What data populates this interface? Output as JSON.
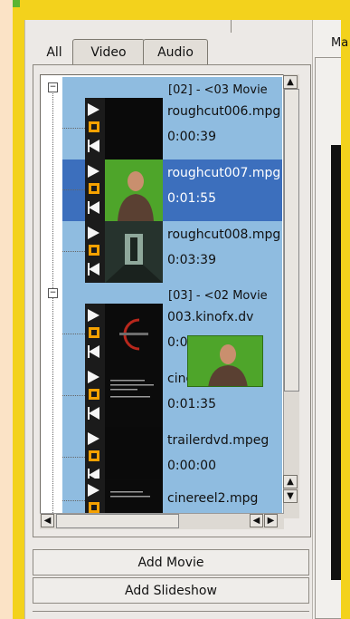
{
  "app": {
    "right_pane_label": "Ma"
  },
  "tabs": [
    {
      "label": "All",
      "active": true
    },
    {
      "label": "Video",
      "active": false
    },
    {
      "label": "Audio",
      "active": false
    }
  ],
  "groups": [
    {
      "label": "[02] - <03 Movie",
      "items": [
        {
          "name": "roughcut006.mpg",
          "duration": "0:00:39",
          "selected": false,
          "thumb": "dark"
        },
        {
          "name": "roughcut007.mpg",
          "duration": "0:01:55",
          "selected": true,
          "thumb": "person-green"
        },
        {
          "name": "roughcut008.mpg",
          "duration": "0:03:39",
          "selected": false,
          "thumb": "corridor"
        }
      ]
    },
    {
      "label": "[03] - <02 Movie",
      "items": [
        {
          "name": "003.kinofx.dv",
          "duration": "0:00:05",
          "selected": false,
          "thumb": "logo"
        },
        {
          "name": "cinereel1.mpg",
          "duration": "0:01:35",
          "selected": false,
          "thumb": "text"
        },
        {
          "name": "trailerdvd.mpeg",
          "duration": "0:00:00",
          "selected": false,
          "thumb": "dark"
        },
        {
          "name": "cinereel2.mpg",
          "duration": "",
          "selected": false,
          "thumb": "text"
        }
      ]
    }
  ],
  "buttons": {
    "add_movie": "Add Movie",
    "add_slideshow": "Add Slideshow"
  },
  "scroll_arrows": {
    "up": "▲",
    "down": "▼",
    "left": "◀",
    "right": "▶"
  },
  "colors": {
    "selection": "#3c6fbd",
    "row_bg": "#8fbce0",
    "accent": "#f3d21c"
  }
}
